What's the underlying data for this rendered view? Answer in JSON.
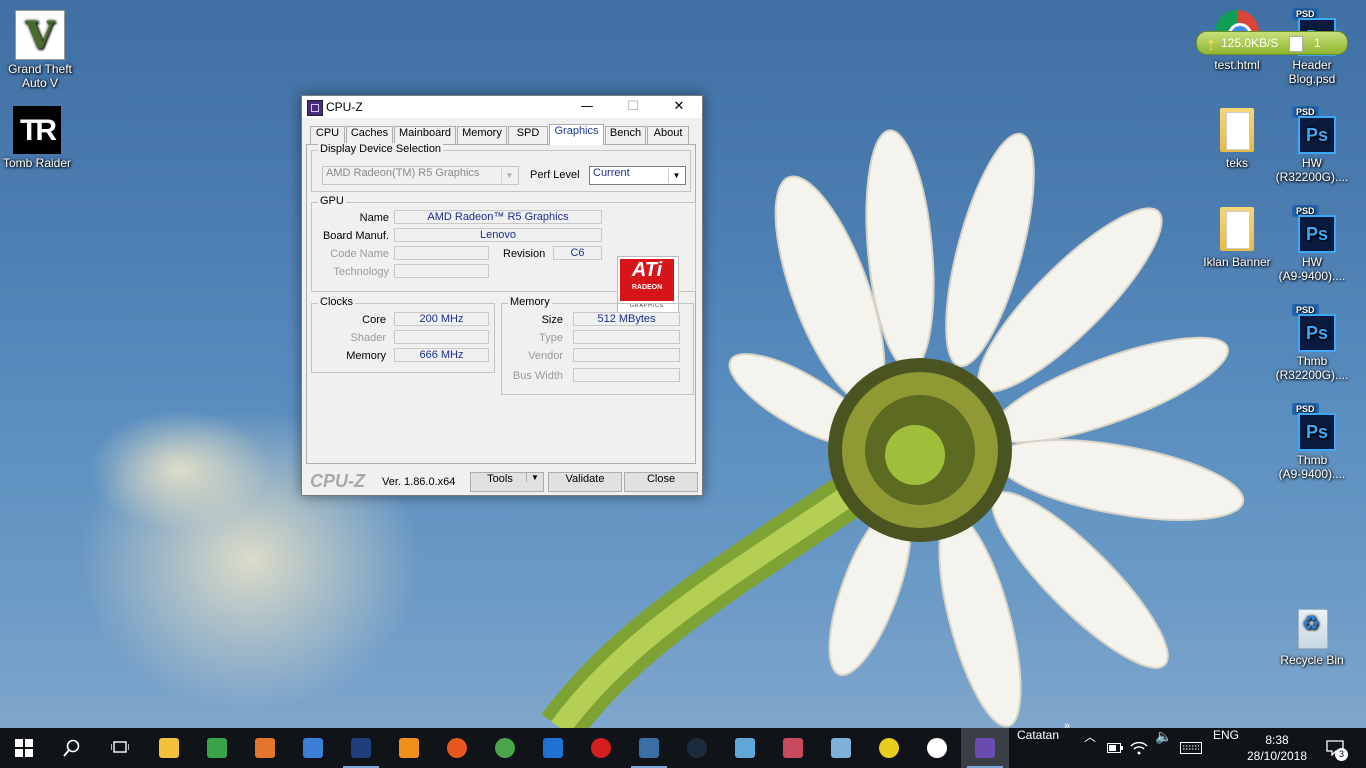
{
  "desktop": {
    "icons_left": [
      {
        "label_line1": "Grand Theft",
        "label_line2": "Auto V",
        "icon": "gta-v-icon"
      },
      {
        "label_line1": "Tomb Raider",
        "label_line2": "",
        "icon": "tomb-raider-icon"
      }
    ],
    "icons_right": [
      {
        "label_line1": "test.html",
        "label_line2": "",
        "icon": "chrome-html-icon"
      },
      {
        "label_line1": "Header",
        "label_line2": "Blog.psd",
        "icon": "psd-icon"
      },
      {
        "label_line1": "teks",
        "label_line2": "",
        "icon": "folder-icon"
      },
      {
        "label_line1": "HW",
        "label_line2": "(R32200G)....",
        "icon": "psd-icon"
      },
      {
        "label_line1": "Iklan Banner",
        "label_line2": "",
        "icon": "folder-icon"
      },
      {
        "label_line1": "HW",
        "label_line2": "(A9-9400)....",
        "icon": "psd-icon"
      },
      {
        "label_line1": "Thmb",
        "label_line2": "(R32200G)....",
        "icon": "psd-icon"
      },
      {
        "label_line1": "Thmb",
        "label_line2": "(A9-9400)....",
        "icon": "psd-icon"
      },
      {
        "label_line1": "Recycle Bin",
        "label_line2": "",
        "icon": "recycle-bin-icon"
      }
    ],
    "psd_tag": "PSD",
    "ps_glyph": "Ps",
    "gta_glyph": "V",
    "tr_glyph": "TR",
    "net_meter": {
      "speed": "125.0KB/S",
      "count": "1"
    }
  },
  "window": {
    "title": "CPU-Z",
    "controls": {
      "minimize": "—",
      "maximize": "☐",
      "close": "✕"
    },
    "tabs": [
      "CPU",
      "Caches",
      "Mainboard",
      "Memory",
      "SPD",
      "Graphics",
      "Bench",
      "About"
    ],
    "active_tab": "Graphics",
    "display_selection": {
      "legend": "Display Device Selection",
      "device": "AMD Radeon(TM) R5 Graphics",
      "perf_label": "Perf Level",
      "perf_value": "Current"
    },
    "gpu": {
      "legend": "GPU",
      "name_label": "Name",
      "name": "AMD Radeon™ R5 Graphics",
      "board_label": "Board Manuf.",
      "board": "Lenovo",
      "code_label": "Code Name",
      "code": "",
      "revision_label": "Revision",
      "revision": "C6",
      "tech_label": "Technology",
      "tech": "",
      "logo_ati": "ATi",
      "logo_radeon": "RADEON",
      "logo_graphics": "GRAPHICS"
    },
    "clocks": {
      "legend": "Clocks",
      "core_label": "Core",
      "core": "200 MHz",
      "shader_label": "Shader",
      "shader": "",
      "memory_label": "Memory",
      "memory": "666 MHz"
    },
    "memory": {
      "legend": "Memory",
      "size_label": "Size",
      "size": "512 MBytes",
      "type_label": "Type",
      "type": "",
      "vendor_label": "Vendor",
      "vendor": "",
      "bus_label": "Bus Width",
      "bus": ""
    },
    "footer": {
      "brand": "CPU-Z",
      "version": "Ver. 1.86.0.x64",
      "tools": "Tools",
      "validate": "Validate",
      "close": "Close"
    }
  },
  "taskbar": {
    "apps": [
      {
        "icon": "file-explorer-icon",
        "color": "#f3c23c"
      },
      {
        "icon": "spreadsheet-icon",
        "color": "#3aa34a"
      },
      {
        "icon": "presentation-icon",
        "color": "#e2762d"
      },
      {
        "icon": "document-icon",
        "color": "#3c7fd6"
      },
      {
        "icon": "photoshop-icon",
        "color": "#1e3f7a"
      },
      {
        "icon": "sublime-text-icon",
        "color": "#f08f1c"
      },
      {
        "icon": "firefox-icon",
        "color": "#e7571f"
      },
      {
        "icon": "chrome-icon",
        "color": "#4aa54a"
      },
      {
        "icon": "edge-icon",
        "color": "#1d73d4"
      },
      {
        "icon": "record-icon",
        "color": "#d21f1f"
      },
      {
        "icon": "app-eagle-icon",
        "color": "#3a6fa6"
      },
      {
        "icon": "steam-icon",
        "color": "#1b2a3d"
      },
      {
        "icon": "app-blue-icon",
        "color": "#5fa7d9"
      },
      {
        "icon": "app-umbrella-icon",
        "color": "#c84a5e"
      },
      {
        "icon": "paint-icon",
        "color": "#7fb0d8"
      },
      {
        "icon": "app-cross-icon",
        "color": "#e8cd1e"
      },
      {
        "icon": "settings-icon",
        "color": "#ffffff"
      },
      {
        "icon": "cpu-z-icon",
        "color": "#6a4bb0"
      }
    ],
    "tray_label": "Catatan",
    "tray_expand": "»",
    "lang": "ENG",
    "time": "8:38",
    "date": "28/10/2018",
    "notification_count": "3"
  }
}
